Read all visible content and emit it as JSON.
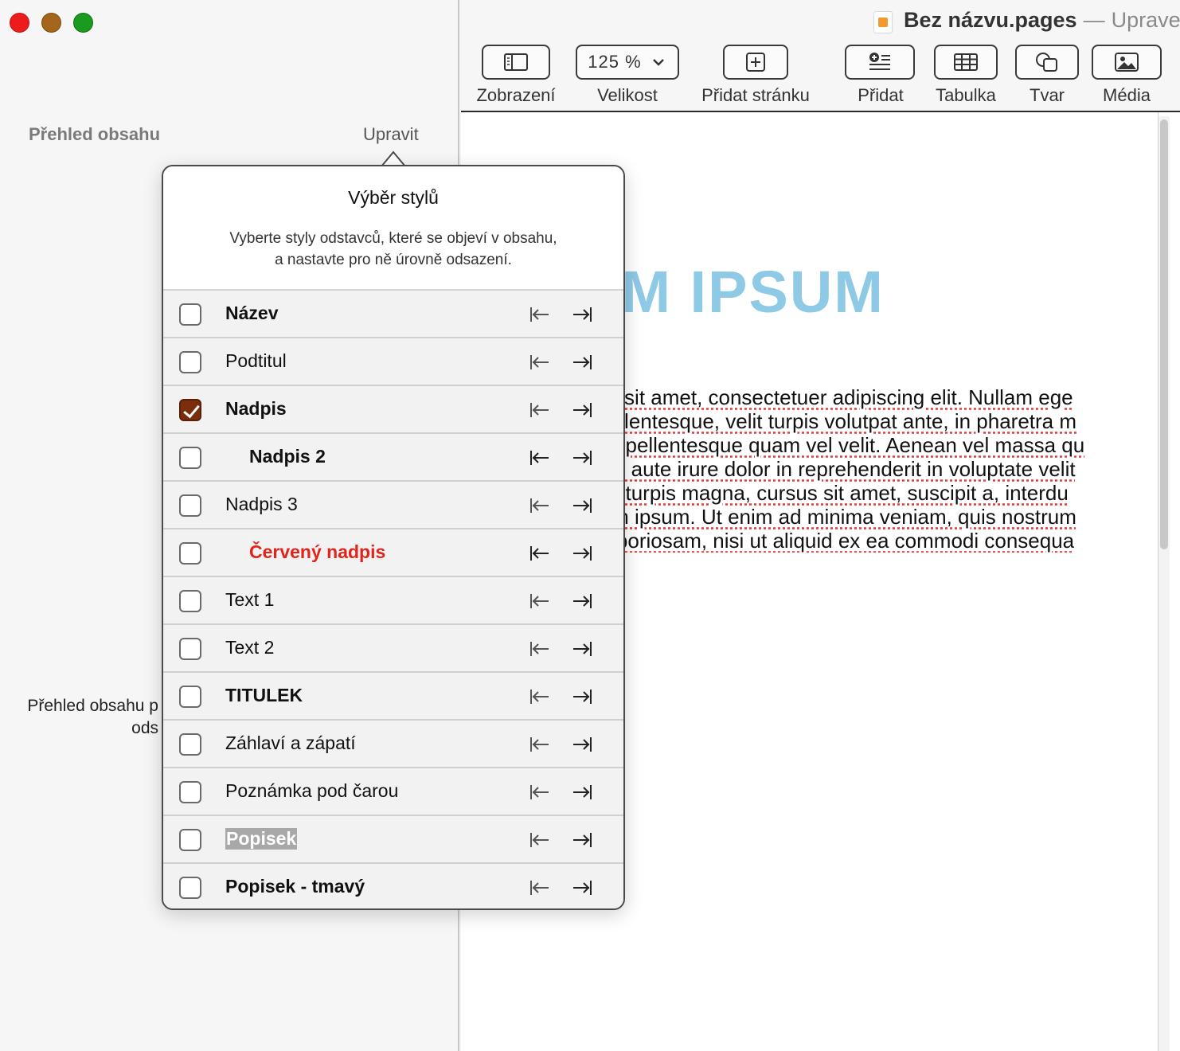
{
  "window": {
    "document_name": "Bez názvu.pages",
    "separator": "—",
    "document_state": "Upraveno"
  },
  "sidebar": {
    "title": "Přehled obsahu",
    "edit_label": "Upravit",
    "hint_line1": "Přehled obsahu p",
    "hint_line2": "ods"
  },
  "toolbar": {
    "view_label": "Zobrazení",
    "zoom_value": "125 %",
    "zoom_label": "Velikost",
    "add_page_label": "Přidat stránku",
    "insert_label": "Přidat",
    "table_label": "Tabulka",
    "shape_label": "Tvar",
    "media_label": "Média"
  },
  "document": {
    "heading": "EM IPSUM",
    "lines": [
      "dolor sit amet, consectetuer adipiscing elit. Nullam ege",
      "ra pellentesque, velit turpis volutpat ante, in pharetra m",
      "teger pellentesque quam vel velit. Aenean vel massa qu",
      ". Duis aute irure dolor in reprehenderit in voluptate velit",
      " Nulla turpis magna, cursus sit amet, suscipit a, interdu",
      "bulum ipsum. Ut enim ad minima veniam, quis nostrum",
      "pit laboriosam, nisi ut aliquid ex ea commodi consequa"
    ]
  },
  "popover": {
    "title": "Výběr stylů",
    "description_line1": "Vyberte styly odstavců, které se objeví v obsahu,",
    "description_line2": "a nastavte pro ně úrovně odsazení.",
    "styles": [
      {
        "label": "Název",
        "checked": false
      },
      {
        "label": "Podtitul",
        "checked": false
      },
      {
        "label": "Nadpis",
        "checked": true
      },
      {
        "label": "Nadpis 2",
        "checked": false
      },
      {
        "label": "Nadpis 3",
        "checked": false
      },
      {
        "label": "Červený nadpis",
        "checked": false
      },
      {
        "label": "Text 1",
        "checked": false
      },
      {
        "label": "Text 2",
        "checked": false
      },
      {
        "label": "TITULEK",
        "checked": false
      },
      {
        "label": "Záhlaví a zápatí",
        "checked": false
      },
      {
        "label": "Poznámka pod čarou",
        "checked": false
      },
      {
        "label": "Popisek",
        "checked": false
      },
      {
        "label": "Popisek - tmavý",
        "checked": false
      }
    ]
  },
  "colors": {
    "accent_checkbox": "#7a2e0c",
    "heading_blue": "#8ec9e6",
    "red_style": "#e0241b",
    "spellcheck": "#e43b3b"
  }
}
